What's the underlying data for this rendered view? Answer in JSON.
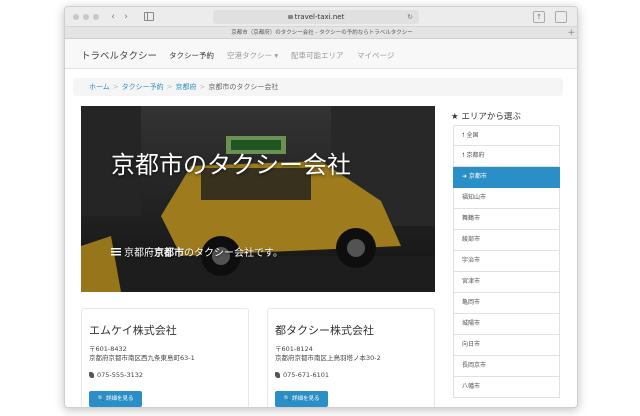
{
  "browser": {
    "url": "travel-taxi.net",
    "tab_title": "京都市（京都府）のタクシー会社 - タクシーの予約ならトラベルタクシー"
  },
  "navbar": {
    "brand": "トラベルタクシー",
    "links": [
      "タクシー予約",
      "空港タクシー ▾",
      "配車可能エリア",
      "マイページ"
    ]
  },
  "breadcrumb": {
    "home": "ホーム",
    "reserve": "タクシー予約",
    "pref": "京都府",
    "current": "京都市のタクシー会社"
  },
  "hero": {
    "title": "京都市のタクシー会社",
    "sub_pref": "京都府",
    "sub_city": "京都市",
    "sub_suffix": "のタクシー会社です。"
  },
  "companies": [
    {
      "name": "エムケイ株式会社",
      "postal": "〒601-8432",
      "address": "京都府京都市南区西九条東島町63-1",
      "tel": "075-555-3132",
      "button": "詳細を見る"
    },
    {
      "name": "都タクシー株式会社",
      "postal": "〒601-8124",
      "address": "京都府京都市南区上鳥羽塔ノ本30-2",
      "tel": "075-671-6101",
      "button": "詳細を見る"
    }
  ],
  "sidebar": {
    "title": "★ エリアから選ぶ",
    "items": [
      "全国",
      "京都府",
      "京都市",
      "福知山市",
      "舞鶴市",
      "綾部市",
      "宇治市",
      "宮津市",
      "亀岡市",
      "城陽市",
      "向日市",
      "長岡京市",
      "八幡市"
    ],
    "active_index": 2
  },
  "colors": {
    "accent": "#2a8fc7",
    "taxi": "#e8b92b"
  }
}
